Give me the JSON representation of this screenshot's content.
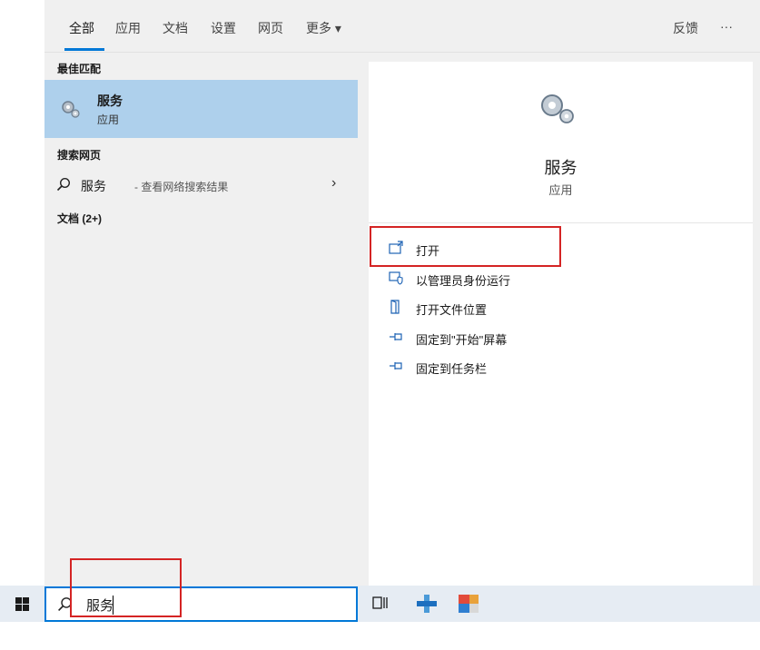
{
  "tabs": {
    "all": "全部",
    "apps": "应用",
    "docs": "文档",
    "settings": "设置",
    "web": "网页",
    "more": "更多 ▾",
    "feedback": "反馈",
    "ellipsis": "···"
  },
  "left": {
    "best_match_header": "最佳匹配",
    "best_match": {
      "name": "服务",
      "type": "应用",
      "icon": "services-gear-icon"
    },
    "web_header": "搜索网页",
    "web_item": {
      "label": "服务",
      "suffix": "- 查看网络搜索结果",
      "arrow": "›"
    },
    "docs_header": "文档 (2+)"
  },
  "detail": {
    "title": "服务",
    "type": "应用",
    "actions": [
      {
        "label": "打开",
        "icon": "open-window-icon"
      },
      {
        "label": "以管理员身份运行",
        "icon": "run-as-admin-icon"
      },
      {
        "label": "打开文件位置",
        "icon": "file-location-icon"
      },
      {
        "label": "固定到\"开始\"屏幕",
        "icon": "pin-icon"
      },
      {
        "label": "固定到任务栏",
        "icon": "pin-icon"
      }
    ]
  },
  "taskbar": {
    "search_value": "服务"
  },
  "colors": {
    "accent": "#0078d7",
    "highlight": "#aed0ec",
    "annotation": "#d42424"
  }
}
